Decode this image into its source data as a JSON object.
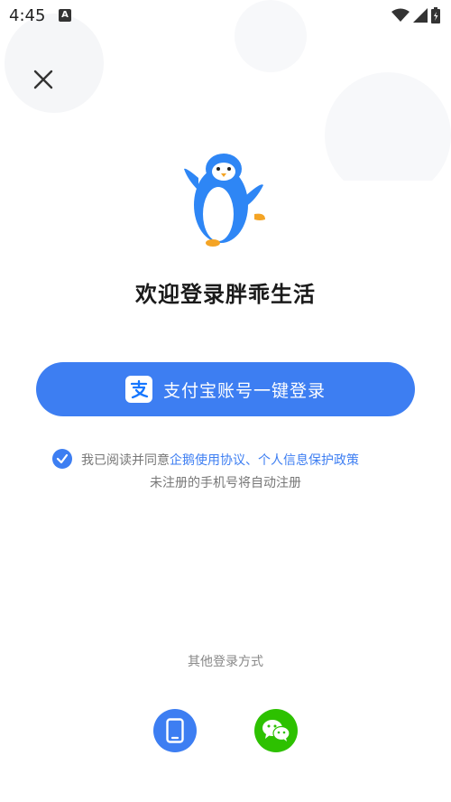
{
  "status_bar": {
    "time": "4:45",
    "notification_icon": "a-letter-icon",
    "icons": [
      "wifi-icon",
      "signal-icon",
      "battery-icon"
    ]
  },
  "header": {
    "close_icon": "close-icon"
  },
  "mascot": {
    "icon": "penguin-mascot-icon"
  },
  "welcome": {
    "title": "欢迎登录胖乖生活"
  },
  "primary_login": {
    "label": "支付宝账号一键登录",
    "icon": "alipay-icon",
    "color": "#3d7ef2"
  },
  "agreement": {
    "checked": true,
    "prefix": "我已阅读并同意",
    "link1": "企鹅使用协议",
    "separator": "、",
    "link2": "个人信息保护政策",
    "note": "未注册的手机号将自动注册"
  },
  "other_login": {
    "title": "其他登录方式",
    "methods": [
      {
        "icon": "phone-icon",
        "color": "#3d7ef2"
      },
      {
        "icon": "wechat-icon",
        "color": "#2dc100"
      }
    ]
  }
}
